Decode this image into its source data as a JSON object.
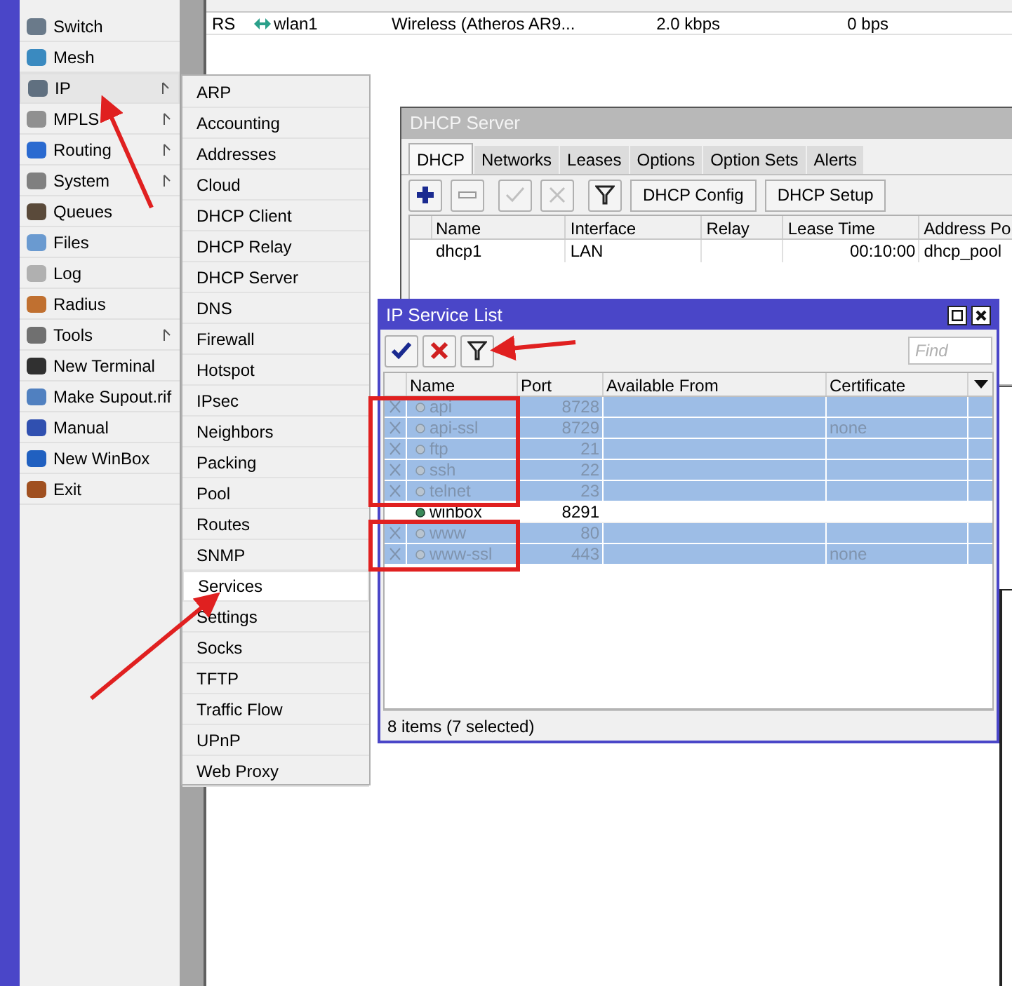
{
  "sidebar": {
    "items": [
      {
        "label": "Switch",
        "selected": false,
        "has_submenu": false
      },
      {
        "label": "Mesh",
        "selected": false,
        "has_submenu": false
      },
      {
        "label": "IP",
        "selected": true,
        "has_submenu": true
      },
      {
        "label": "MPLS",
        "selected": false,
        "has_submenu": true
      },
      {
        "label": "Routing",
        "selected": false,
        "has_submenu": true
      },
      {
        "label": "System",
        "selected": false,
        "has_submenu": true
      },
      {
        "label": "Queues",
        "selected": false,
        "has_submenu": false
      },
      {
        "label": "Files",
        "selected": false,
        "has_submenu": false
      },
      {
        "label": "Log",
        "selected": false,
        "has_submenu": false
      },
      {
        "label": "Radius",
        "selected": false,
        "has_submenu": false
      },
      {
        "label": "Tools",
        "selected": false,
        "has_submenu": true
      },
      {
        "label": "New Terminal",
        "selected": false,
        "has_submenu": false
      },
      {
        "label": "Make Supout.rif",
        "selected": false,
        "has_submenu": false
      },
      {
        "label": "Manual",
        "selected": false,
        "has_submenu": false
      },
      {
        "label": "New WinBox",
        "selected": false,
        "has_submenu": false
      },
      {
        "label": "Exit",
        "selected": false,
        "has_submenu": false
      }
    ]
  },
  "ip_submenu": {
    "items": [
      {
        "label": "ARP",
        "selected": false
      },
      {
        "label": "Accounting",
        "selected": false
      },
      {
        "label": "Addresses",
        "selected": false
      },
      {
        "label": "Cloud",
        "selected": false
      },
      {
        "label": "DHCP Client",
        "selected": false
      },
      {
        "label": "DHCP Relay",
        "selected": false
      },
      {
        "label": "DHCP Server",
        "selected": false
      },
      {
        "label": "DNS",
        "selected": false
      },
      {
        "label": "Firewall",
        "selected": false
      },
      {
        "label": "Hotspot",
        "selected": false
      },
      {
        "label": "IPsec",
        "selected": false
      },
      {
        "label": "Neighbors",
        "selected": false
      },
      {
        "label": "Packing",
        "selected": false
      },
      {
        "label": "Pool",
        "selected": false
      },
      {
        "label": "Routes",
        "selected": false
      },
      {
        "label": "SNMP",
        "selected": false
      },
      {
        "label": "Services",
        "selected": true
      },
      {
        "label": "Settings",
        "selected": false
      },
      {
        "label": "Socks",
        "selected": false
      },
      {
        "label": "TFTP",
        "selected": false
      },
      {
        "label": "Traffic Flow",
        "selected": false
      },
      {
        "label": "UPnP",
        "selected": false
      },
      {
        "label": "Web Proxy",
        "selected": false
      }
    ]
  },
  "interfaces_window": {
    "rows": [
      {
        "flags": "RS",
        "name": "wlan1",
        "type": "Wireless (Atheros AR9...",
        "tx": "2.0 kbps",
        "rx": "0 bps"
      }
    ]
  },
  "dhcp_server_window": {
    "title": "DHCP Server",
    "tabs": [
      {
        "label": "DHCP",
        "selected": true
      },
      {
        "label": "Networks",
        "selected": false
      },
      {
        "label": "Leases",
        "selected": false
      },
      {
        "label": "Options",
        "selected": false
      },
      {
        "label": "Option Sets",
        "selected": false
      },
      {
        "label": "Alerts",
        "selected": false
      }
    ],
    "tool_buttons": [
      {
        "kind": "add",
        "disabled": false
      },
      {
        "kind": "remove",
        "disabled": false
      },
      {
        "kind": "enable",
        "disabled": true
      },
      {
        "kind": "disable",
        "disabled": true
      },
      {
        "kind": "filter"
      }
    ],
    "text_buttons": [
      "DHCP Config",
      "DHCP Setup"
    ],
    "columns": [
      "Name",
      "Interface",
      "Relay",
      "Lease Time",
      "Address Po"
    ],
    "rows": [
      {
        "cells": [
          "dhcp1",
          "LAN",
          "",
          "00:10:00",
          "dhcp_pool"
        ]
      }
    ]
  },
  "ip_service_list": {
    "title": "IP Service List",
    "find_placeholder": "Find",
    "tool_buttons": [
      {
        "kind": "enable"
      },
      {
        "kind": "disable"
      },
      {
        "kind": "filter"
      }
    ],
    "columns": [
      "Name",
      "Port",
      "Available From",
      "Certificate"
    ],
    "rows": [
      {
        "name": "api",
        "port": "8728",
        "certificate": "",
        "disabled": true,
        "selected": true
      },
      {
        "name": "api-ssl",
        "port": "8729",
        "certificate": "none",
        "disabled": true,
        "selected": true
      },
      {
        "name": "ftp",
        "port": "21",
        "certificate": "",
        "disabled": true,
        "selected": true
      },
      {
        "name": "ssh",
        "port": "22",
        "certificate": "",
        "disabled": true,
        "selected": true
      },
      {
        "name": "telnet",
        "port": "23",
        "certificate": "",
        "disabled": true,
        "selected": true
      },
      {
        "name": "winbox",
        "port": "8291",
        "certificate": "",
        "disabled": false,
        "selected": false
      },
      {
        "name": "www",
        "port": "80",
        "certificate": "",
        "disabled": true,
        "selected": true
      },
      {
        "name": "www-ssl",
        "port": "443",
        "certificate": "none",
        "disabled": true,
        "selected": true
      }
    ],
    "status": "8 items (7 selected)"
  }
}
